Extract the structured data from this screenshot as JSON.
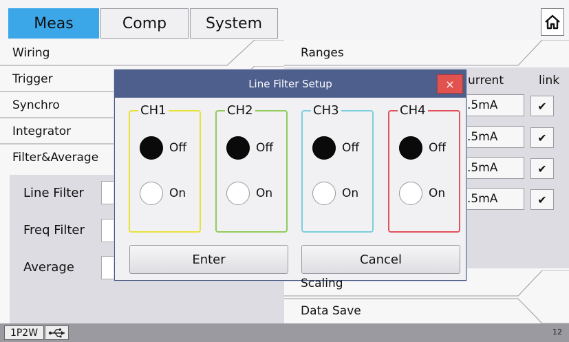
{
  "tabs": [
    {
      "label": "Meas",
      "active": true
    },
    {
      "label": "Comp",
      "active": false
    },
    {
      "label": "System",
      "active": false
    }
  ],
  "home_icon": "home-icon",
  "left_menu": [
    "Wiring",
    "Trigger",
    "Synchro",
    "Integrator",
    "Filter&Average"
  ],
  "filter_settings": {
    "line_filter_label": "Line Filter",
    "freq_filter_label": "Freq Filter",
    "average_label": "Average"
  },
  "right_panel": {
    "ranges_label": "Ranges",
    "current_header": "urrent",
    "link_header": "link",
    "range_values": [
      ".5mA",
      ".5mA",
      ".5mA",
      ".5mA"
    ],
    "link_mark": "✔",
    "scaling_label": "Scaling",
    "data_save_label": "Data Save"
  },
  "dialog": {
    "title": "Line Filter Setup",
    "close_symbol": "×",
    "channels": [
      {
        "name": "CH1",
        "color": "#e6e23a",
        "selected": "Off"
      },
      {
        "name": "CH2",
        "color": "#8fcc5a",
        "selected": "Off"
      },
      {
        "name": "CH3",
        "color": "#7ccfdc",
        "selected": "Off"
      },
      {
        "name": "CH4",
        "color": "#e2525c",
        "selected": "Off"
      }
    ],
    "off_label": "Off",
    "on_label": "On",
    "enter_label": "Enter",
    "cancel_label": "Cancel"
  },
  "status_bar": {
    "wiring": "1P2W",
    "usb_icon": "usb-icon",
    "page_number": "12"
  },
  "colors": {
    "active_tab": "#3ba6e8",
    "dialog_title_bar": "#4e5f8e",
    "close_button": "#e2524f"
  }
}
